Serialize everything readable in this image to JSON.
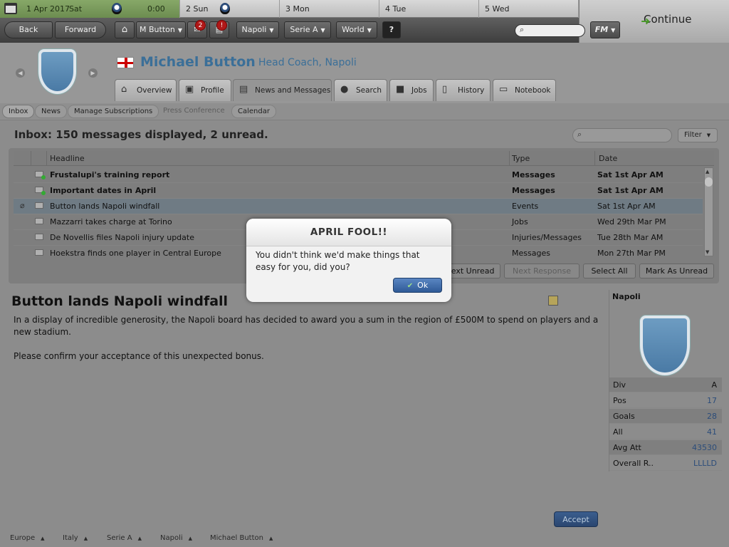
{
  "calendar": {
    "today_date": "1 Apr 2017",
    "today_day": "Sat",
    "today_time": "0:00",
    "days": [
      "2 Sun",
      "3 Mon",
      "4 Tue",
      "5 Wed"
    ]
  },
  "continue_label": "Continue",
  "toolbar": {
    "back": "Back",
    "forward": "Forward",
    "manager": "M Button",
    "badge_messages": "2",
    "badge_alerts": "!",
    "club": "Napoli",
    "league": "Serie A",
    "world": "World",
    "help": "?",
    "fm": "FM"
  },
  "header": {
    "name": "Michael Button",
    "role": "Head Coach, Napoli",
    "tabs": [
      "Overview",
      "Profile",
      "News and Messages",
      "Search",
      "Jobs",
      "History",
      "Notebook"
    ]
  },
  "subtabs": [
    "Inbox",
    "News",
    "Manage Subscriptions",
    "Press Conference",
    "Calendar"
  ],
  "inbox": {
    "title": "Inbox: 150 messages displayed, 2 unread.",
    "filter": "Filter",
    "columns": {
      "headline": "Headline",
      "type": "Type",
      "date": "Date"
    },
    "rows": [
      {
        "headline": "Frustalupi's training report",
        "type": "Messages",
        "date": "Sat 1st Apr AM"
      },
      {
        "headline": "Important dates in April",
        "type": "Messages",
        "date": "Sat 1st Apr AM"
      },
      {
        "headline": "Button lands Napoli windfall",
        "type": "Events",
        "date": "Sat 1st Apr AM"
      },
      {
        "headline": "Mazzarri takes charge at Torino",
        "type": "Jobs",
        "date": "Wed 29th Mar PM"
      },
      {
        "headline": "De Novellis files Napoli injury update",
        "type": "Injuries/Messages",
        "date": "Tue 28th Mar AM"
      },
      {
        "headline": "Hoekstra finds one player in Central Europe",
        "type": "Messages",
        "date": "Mon 27th Mar PM"
      }
    ],
    "buttons": {
      "next_unread": "Next Unread",
      "next_response": "Next Response",
      "select_all": "Select All",
      "mark_unread": "Mark As Unread"
    }
  },
  "article": {
    "title": "Button lands Napoli windfall",
    "p1": "In a display of incredible generosity, the Napoli board has decided to award you a sum in the region of £500M to spend on players and a new stadium.",
    "p2": "Please confirm your acceptance of this unexpected bonus.",
    "accept": "Accept"
  },
  "club": {
    "name": "Napoli",
    "stats": [
      {
        "k": "Div",
        "v": "A"
      },
      {
        "k": "Pos",
        "v": "17"
      },
      {
        "k": "Goals",
        "v": "28"
      },
      {
        "k": "All",
        "v": "41"
      },
      {
        "k": "Avg Att",
        "v": "43530"
      },
      {
        "k": "Overall R..",
        "v": "LLLLD"
      }
    ]
  },
  "footer": [
    "Europe",
    "Italy",
    "Serie A",
    "Napoli",
    "Michael Button"
  ],
  "dialog": {
    "title": "APRIL FOOL!!",
    "body": "You didn't think we'd make things that easy for you, did you?",
    "ok": "Ok"
  }
}
